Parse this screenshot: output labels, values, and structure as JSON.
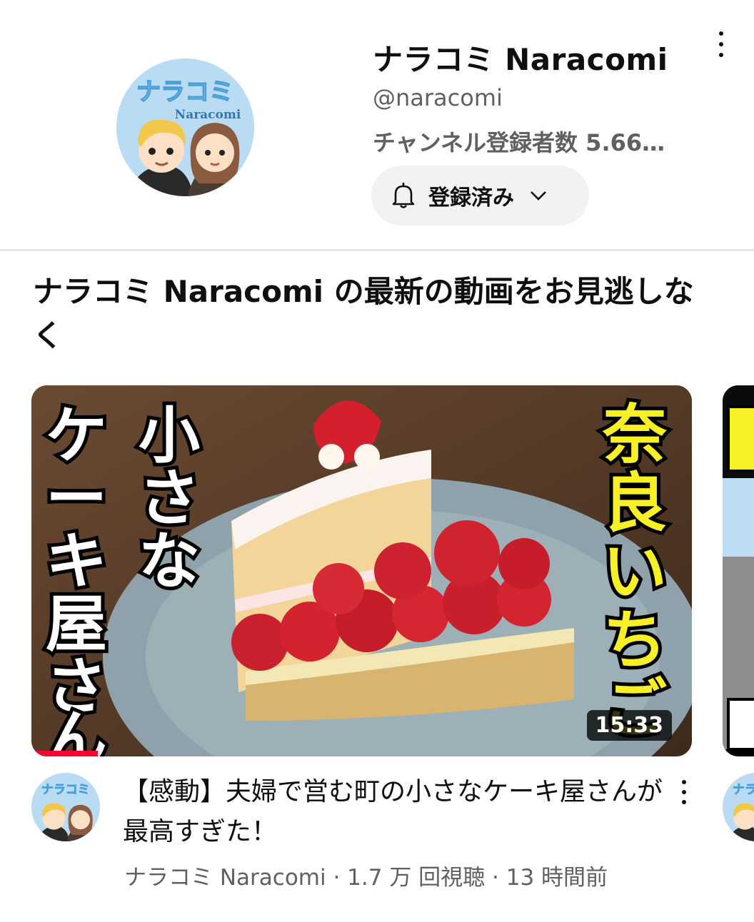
{
  "channel": {
    "name": "ナラコミ Naracomi",
    "handle": "@naracomi",
    "subscribers": "チャンネル登録者数 5.66…",
    "subscribe_button_label": "登録済み",
    "avatar_text_jp": "ナラコミ",
    "avatar_text_en": "Naracomi"
  },
  "section": {
    "title": "ナラコミ Naracomi の最新の動画をお見逃しなく"
  },
  "video": {
    "title": "【感動】夫婦で営む町の小さなケーキ屋さんが最高すぎた！",
    "duration": "15:33",
    "channel": "ナラコミ Naracomi",
    "views": "1.7 万 回視聴",
    "age": "13 時間前",
    "meta": "ナラコミ Naracomi · 1.7 万 回視聴 · 13 時間前",
    "thumbnail_text_left": "小さなケーキ屋さん",
    "thumbnail_text_right": "奈良いちご",
    "watch_progress": 0.1
  },
  "colors": {
    "progress": "#ff0033",
    "thumbnail_yellow": "#f7f024",
    "secondary_text": "#606060"
  },
  "icons": [
    "more-vert-icon",
    "bell-icon",
    "chevron-down-icon"
  ]
}
